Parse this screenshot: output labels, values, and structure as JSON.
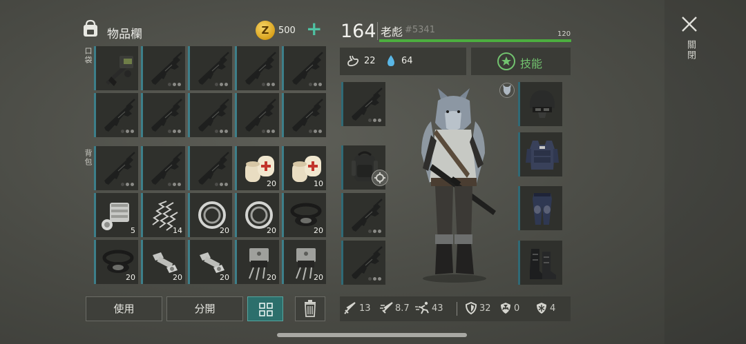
{
  "inventory": {
    "title": "物品欄",
    "currency_symbol": "Z",
    "currency_amount": "500",
    "add_symbol": "+",
    "pocket_label": "口袋",
    "backpack_label": "背包",
    "pocket_slots": [
      {
        "item": "turret-icon",
        "qty": ""
      },
      {
        "item": "assault-rifle-icon",
        "qty": ""
      },
      {
        "item": "assault-rifle-icon",
        "qty": ""
      },
      {
        "item": "assault-rifle-icon",
        "qty": ""
      },
      {
        "item": "assault-rifle-icon",
        "qty": ""
      },
      {
        "item": "assault-rifle-icon",
        "qty": ""
      },
      {
        "item": "assault-rifle-icon",
        "qty": ""
      },
      {
        "item": "assault-rifle-icon",
        "qty": ""
      },
      {
        "item": "assault-rifle-icon",
        "qty": ""
      },
      {
        "item": "assault-rifle-icon",
        "qty": ""
      }
    ],
    "backpack_slots": [
      {
        "item": "assault-rifle-icon",
        "qty": ""
      },
      {
        "item": "assault-rifle-icon",
        "qty": ""
      },
      {
        "item": "assault-rifle-icon",
        "qty": ""
      },
      {
        "item": "bandage-icon",
        "qty": "20"
      },
      {
        "item": "bandage-icon",
        "qty": "10"
      },
      {
        "item": "engine-part-icon",
        "qty": "5"
      },
      {
        "item": "spring-icon",
        "qty": "14"
      },
      {
        "item": "bearing-icon",
        "qty": "20"
      },
      {
        "item": "bearing-icon",
        "qty": "20"
      },
      {
        "item": "seal-ring-icon",
        "qty": "20"
      },
      {
        "item": "seal-ring-icon",
        "qty": "20"
      },
      {
        "item": "bolt-icon",
        "qty": "20"
      },
      {
        "item": "bolt-icon",
        "qty": "20"
      },
      {
        "item": "transistor-icon",
        "qty": "20"
      },
      {
        "item": "transistor-icon",
        "qty": "20"
      }
    ],
    "buttons": {
      "use": "使用",
      "split": "分開"
    }
  },
  "character": {
    "level": "164",
    "name": "老彪",
    "player_id": "#5341",
    "hp_max": "120",
    "hp_fraction": 1.0,
    "food": "22",
    "water": "64",
    "skills_label": "技能",
    "stats": {
      "attack": "13",
      "attack_speed": "8.7",
      "move_speed": "43",
      "armor": "32",
      "radiation": "0",
      "cold": "4"
    }
  },
  "close_label": "關閉",
  "colors": {
    "accent": "#3d7f8a",
    "hp_bar": "#4cae3f",
    "skill_green": "#72c36f",
    "add_button": "#4fc2a3"
  }
}
